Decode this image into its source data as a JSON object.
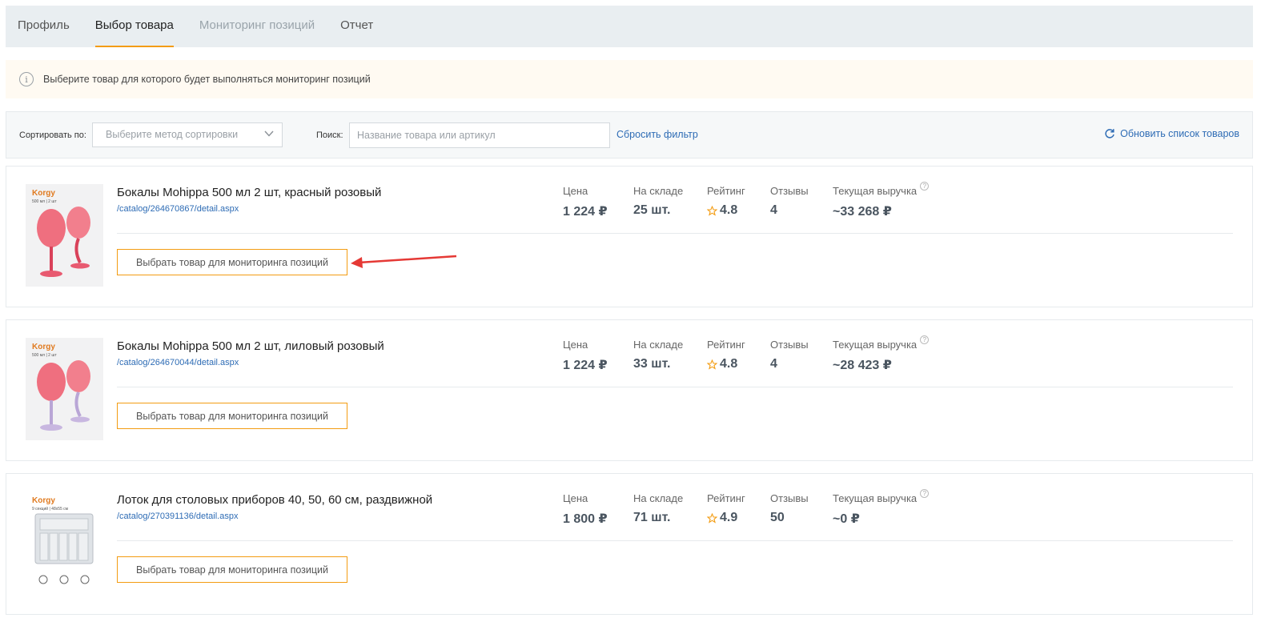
{
  "tabs": [
    {
      "label": "Профиль"
    },
    {
      "label": "Выбор товара"
    },
    {
      "label": "Мониторинг позиций"
    },
    {
      "label": "Отчет"
    }
  ],
  "notice": {
    "icon": "info-icon",
    "text": "Выберите товар для которого будет выполняться мониторинг позиций"
  },
  "filters": {
    "sort_label": "Сортировать по:",
    "sort_placeholder": "Выберите метод сортировки",
    "search_label": "Поиск:",
    "search_placeholder": "Название товара или артикул",
    "reset_label": "Сбросить фильтр",
    "refresh_label": "Обновить список товаров"
  },
  "stat_labels": {
    "price": "Цена",
    "stock": "На складе",
    "rating": "Рейтинг",
    "reviews": "Отзывы",
    "revenue": "Текущая выручка"
  },
  "button_label": "Выбрать товар для мониторинга позиций",
  "products": [
    {
      "brand": "Korgy",
      "brand_sub": "500 мл | 2 шт",
      "title": "Бокалы Mohippa 500 мл 2 шт, красный розовый",
      "url": "/catalog/264670867/detail.aspx",
      "price": "1 224 ₽",
      "stock": "25 шт.",
      "rating": "4.8",
      "reviews": "4",
      "revenue": "~33 268 ₽"
    },
    {
      "brand": "Korgy",
      "brand_sub": "500 мл | 2 шт",
      "title": "Бокалы Mohippa 500 мл 2 шт, лиловый розовый",
      "url": "/catalog/264670044/detail.aspx",
      "price": "1 224 ₽",
      "stock": "33 шт.",
      "rating": "4.8",
      "reviews": "4",
      "revenue": "~28 423 ₽"
    },
    {
      "brand": "Korgy",
      "brand_sub": "9 секций | 48x55 см",
      "title": "Лоток для столовых приборов 40, 50, 60 см, раздвижной",
      "url": "/catalog/270391136/detail.aspx",
      "price": "1 800 ₽",
      "stock": "71 шт.",
      "rating": "4.9",
      "reviews": "50",
      "revenue": "~0 ₽"
    }
  ],
  "colors": {
    "accent": "#f39c12",
    "link": "#2e6cb5",
    "arrow": "#e53935"
  }
}
